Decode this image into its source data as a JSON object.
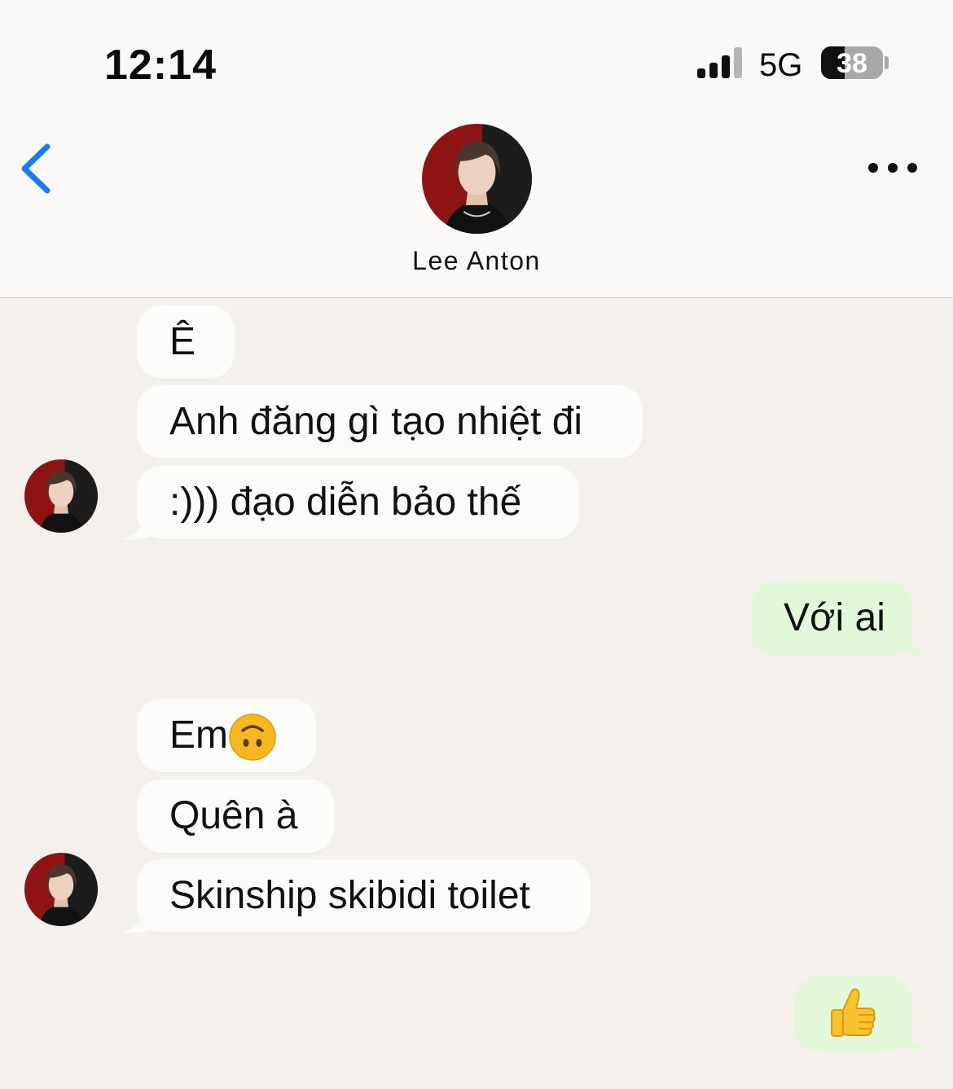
{
  "status_bar": {
    "time": "12:14",
    "network": "5G",
    "battery": "38",
    "battery_level": 0.38
  },
  "header": {
    "back_icon": "chevron-left-icon",
    "more_icon": "ellipsis-icon",
    "contact_name": "Lee Anton",
    "accent_color": "#1a7cf5"
  },
  "messages": [
    {
      "direction": "incoming",
      "text": "Ê"
    },
    {
      "direction": "incoming",
      "text": "Anh đăng gì tạo nhiệt đi"
    },
    {
      "direction": "incoming",
      "text": ":))) đạo diễn bảo thế"
    },
    {
      "direction": "outgoing",
      "text": "Với ai"
    },
    {
      "direction": "incoming",
      "text": "Em",
      "emoji": "upside-down-face-emoji"
    },
    {
      "direction": "incoming",
      "text": "Quên à"
    },
    {
      "direction": "incoming",
      "text": "Skinship skibidi toilet"
    },
    {
      "direction": "outgoing",
      "emoji": "thumbs-up-emoji"
    }
  ],
  "colors": {
    "incoming_bubble": "#fbfbfa",
    "outgoing_bubble": "#e3f8d8",
    "chat_background": "#f4f1ec"
  }
}
